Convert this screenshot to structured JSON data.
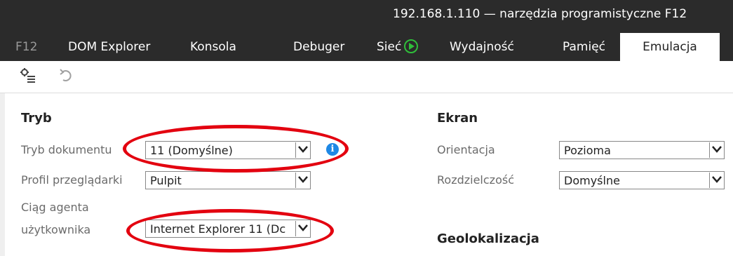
{
  "window": {
    "title": "192.168.1.110 — narzędzia programistyczne F12"
  },
  "tabs": [
    {
      "label": "F12"
    },
    {
      "label": "DOM Explorer"
    },
    {
      "label": "Konsola"
    },
    {
      "label": "Debuger"
    },
    {
      "label": "Sieć"
    },
    {
      "label": "Wydajność"
    },
    {
      "label": "Pamięć"
    },
    {
      "label": "Emulacja"
    }
  ],
  "active_tab": "Emulacja",
  "toolbar": {
    "icons": [
      "settings-list-icon",
      "undo-icon"
    ]
  },
  "mode": {
    "heading": "Tryb",
    "document_mode": {
      "label": "Tryb dokumentu",
      "value": "11 (Domyślne)"
    },
    "browser_profile": {
      "label": "Profil przeglądarki",
      "value": "Pulpit"
    },
    "user_agent": {
      "label_line1": "Ciąg agenta",
      "label_line2": "użytkownika",
      "value": "Internet Explorer 11 (Dc"
    }
  },
  "screen": {
    "heading": "Ekran",
    "orientation": {
      "label": "Orientacja",
      "value": "Pozioma"
    },
    "resolution": {
      "label": "Rozdzielczość",
      "value": "Domyślne"
    }
  },
  "geolocation": {
    "heading": "Geolokalizacja"
  },
  "info_icon": "i",
  "colors": {
    "chrome": "#2b2b2b",
    "highlight": "#e3000f",
    "info": "#1e88e5",
    "play": "#2fbf3a"
  }
}
